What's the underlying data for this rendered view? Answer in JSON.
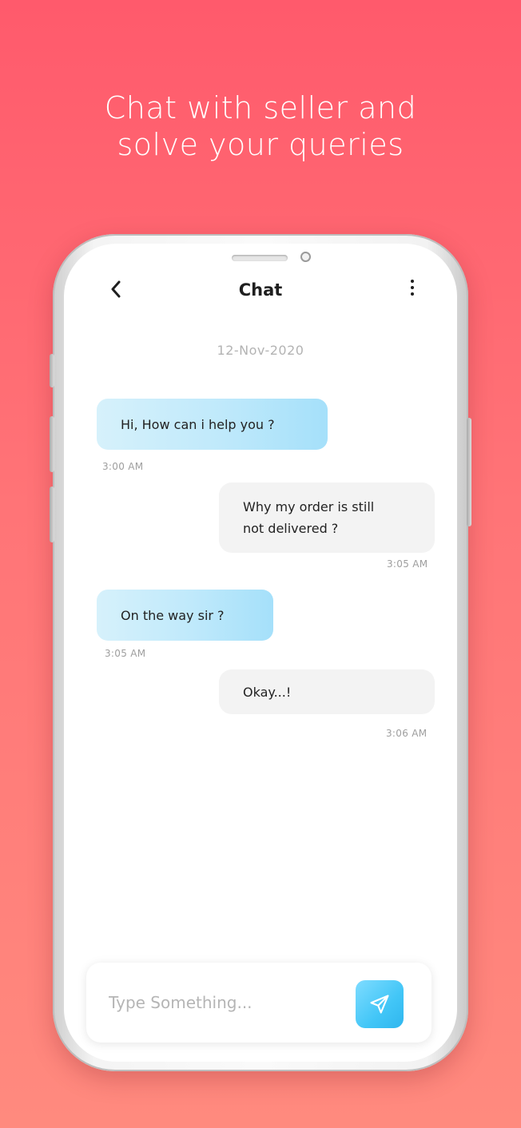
{
  "headline": {
    "line1": "Chat with seller and",
    "line2": "solve your queries"
  },
  "header": {
    "title": "Chat",
    "back_icon": "chevron-left-icon",
    "more_icon": "vertical-dots-icon"
  },
  "date_label": "12-Nov-2020",
  "messages": [
    {
      "direction": "incoming",
      "text": "Hi, How can i help you ?",
      "time": "3:00 AM"
    },
    {
      "direction": "outgoing",
      "text_line1": "Why my order is still",
      "text_line2": "not delivered ?",
      "time": "3:05 AM"
    },
    {
      "direction": "incoming",
      "text": "On the way sir ?",
      "time": "3:05 AM"
    },
    {
      "direction": "outgoing",
      "text": "Okay...!",
      "time": "3:06 AM"
    }
  ],
  "composer": {
    "placeholder": "Type Something...",
    "value": "",
    "send_icon": "send-icon"
  },
  "colors": {
    "background_top": "#ff5a6c",
    "background_bottom": "#ff8a7e",
    "incoming_bubble": "#bfe9fb",
    "outgoing_bubble": "#f3f3f3",
    "send_button": "#42c6f7"
  }
}
